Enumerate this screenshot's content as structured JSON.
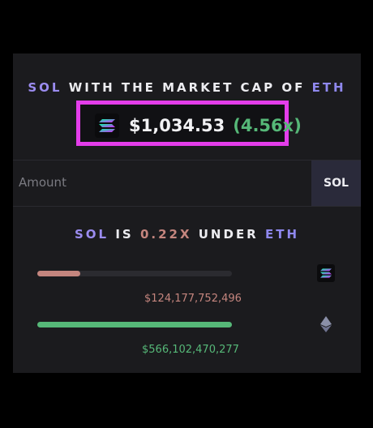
{
  "headline": {
    "part1": "SOL",
    "part2": " WITH THE MARKET CAP OF ",
    "part3": "ETH"
  },
  "price": {
    "value": "$1,034.53",
    "multiplier": "(4.56x)"
  },
  "amount_input": {
    "placeholder": "Amount",
    "unit": "SOL"
  },
  "comparison": {
    "left_token": "SOL",
    "is_text": " IS ",
    "factor": "0.22X",
    "under_text": " UNDER ",
    "right_token": "ETH"
  },
  "bars": [
    {
      "label": "$124,177,752,496",
      "fill_fraction": 0.22,
      "color": "#c4857e"
    },
    {
      "label": "$566,102,470,277",
      "fill_fraction": 1.0,
      "color": "#56b878"
    }
  ],
  "colors": {
    "accent_border": "#e33dea",
    "sol_purple": "#9b8cf0",
    "eth_purple": "#8f88ee",
    "positive": "#56b878",
    "negative": "#c4857e"
  },
  "icons": {
    "main_logo": "solana-icon",
    "mini_sol": "solana-icon",
    "mini_eth": "ethereum-icon"
  }
}
